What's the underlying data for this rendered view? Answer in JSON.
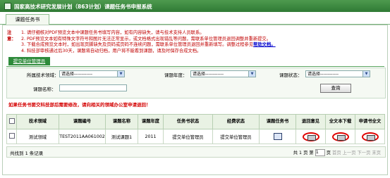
{
  "window": {
    "title": "国家高技术研究发展计划（863计划）课题任务书申报系统"
  },
  "tabs": [
    {
      "label": "课题任务书"
    }
  ],
  "notice": {
    "label": "注意：",
    "items": [
      "1. 请仔细核对PDF预览文本中课题任务书填写内容，如有内容缺失，请与技术支持人员联系。",
      "2. PDF预览文本如有特殊文字符号和图片无法正常显示，或文档格式出现错乱等问题，需联系单位管理员退回调整并重新提交。",
      "3. 下载合成预览文本时，如出现页脚缺失及页码或页码不连续问题，需联系单位管理员退回并重新填写。调整过程参见",
      "4. 科技部审核通过后30天，课题将自动归档，用户将不能看到课题，请及时保存合成文档。"
    ],
    "help_link": "帮助文档。"
  },
  "submit_button": "提交单位管理员",
  "search": {
    "field_label": "所属技术领域：",
    "field_value": "请选择------------",
    "year_label": "课题年度：",
    "year_value": "请选择------------",
    "status_label": "课题状态：",
    "status_value": "请选择------------",
    "name_label": "课题名称：",
    "name_value": "",
    "query_button": "查询"
  },
  "warning": "如果任务书要交科技部后需要修改，请向相关的领域办公室申请退回！",
  "table": {
    "headers": [
      "",
      "技术领域",
      "课题编号",
      "课题名称",
      "课题年度",
      "任务书状态",
      "经费状态",
      "课题任务书",
      "退回意见",
      "全文本下载",
      "申请书全文"
    ],
    "rows": [
      {
        "field": "测试领域",
        "code": "TEST2011AA061002",
        "name": "测试课题1",
        "year": "2011",
        "status": "提交单位管理员",
        "fund_status": "提交单位管理员"
      }
    ]
  },
  "pager": {
    "total": "共找到 1 条记录",
    "total_prefix": "共",
    "page_current": "1",
    "page_label": "页",
    "page_of": "第",
    "page_total": "1",
    "page_suffix": "页",
    "nav": "首页 上一页 下一页 末页"
  },
  "colors": {
    "title_bar": "#2f7a35",
    "warning": "#d40000",
    "highlight": "#e00000"
  }
}
